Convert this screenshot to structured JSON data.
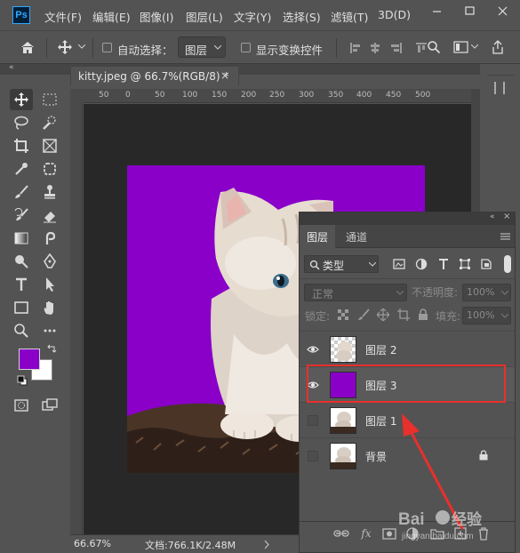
{
  "app": {
    "logo": "Ps"
  },
  "menu": [
    "文件(F)",
    "编辑(E)",
    "图像(I)",
    "图层(L)",
    "文字(Y)",
    "选择(S)",
    "滤镜(T)",
    "3D(D)"
  ],
  "options_bar": {
    "auto_select_label": "自动选择：",
    "auto_select_target": "图层",
    "show_transform_label": "显示变换控件"
  },
  "document": {
    "tab_title": "kitty.jpeg @ 66.7%(RGB/8) *",
    "close_glyph": "×",
    "ruler_ticks": [
      "50",
      "0",
      "50",
      "100",
      "150",
      "200",
      "250",
      "300",
      "350",
      "400",
      "450",
      "500"
    ],
    "canvas_color": "#8a00c8"
  },
  "status": {
    "zoom": "66.67%",
    "doc_info": "文档:766.1K/2.48M"
  },
  "layers_panel": {
    "tabs": [
      "图层",
      "通道"
    ],
    "filter_kind": "类型",
    "blend_mode": "正常",
    "opacity_label": "不透明度:",
    "opacity_value": "100%",
    "lock_label": "锁定:",
    "fill_label": "填充:",
    "fill_value": "100%",
    "layers": [
      {
        "name": "图层 2",
        "visible": true,
        "thumb": "transparent-cat"
      },
      {
        "name": "图层 3",
        "visible": true,
        "thumb": "purple-fill"
      },
      {
        "name": "图层 1",
        "visible": false,
        "thumb": "cat-photo"
      },
      {
        "name": "背景",
        "visible": false,
        "thumb": "cat-photo",
        "locked": true
      }
    ]
  },
  "colors": {
    "highlight": "#e8302c",
    "foreground": "#8a00c8",
    "background": "#ffffff"
  },
  "watermark": "Baidu经验 jingyan.baidu.com"
}
